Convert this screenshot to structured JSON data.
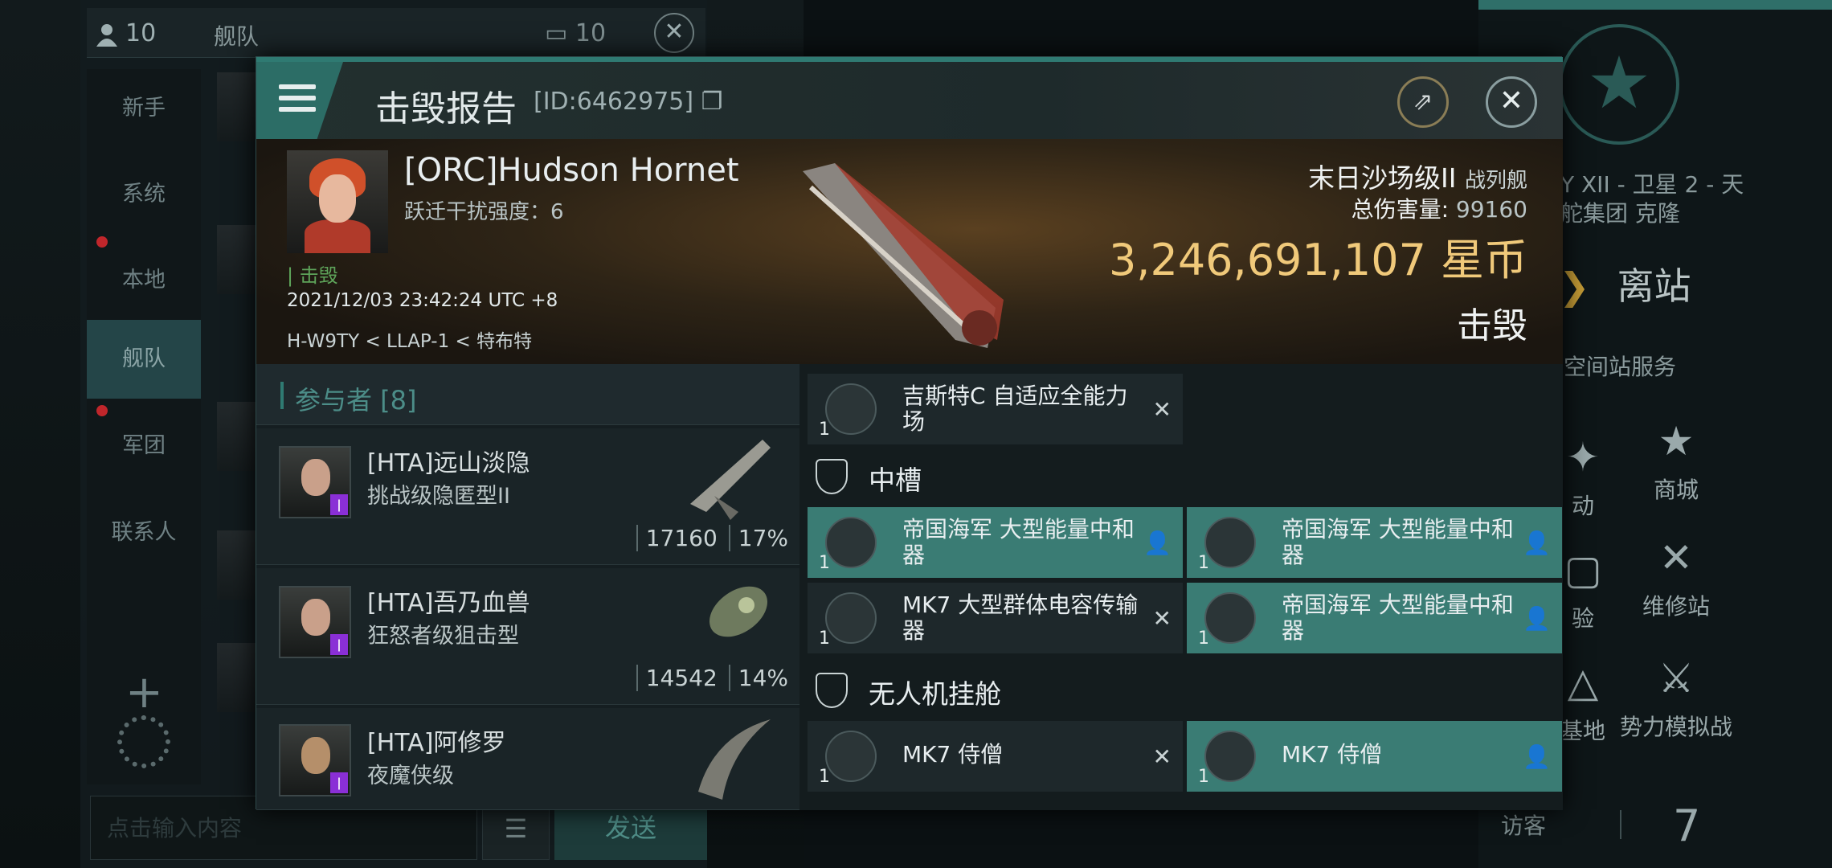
{
  "chat": {
    "member_count": "10",
    "tab": "舰队",
    "unread_count": "10",
    "channels": [
      "新手",
      "系统",
      "本地",
      "舰队",
      "军团",
      "联系人"
    ],
    "input_placeholder": "点击输入内容",
    "send_label": "发送"
  },
  "station": {
    "location_line1": "Y XII - 卫星 2 - 天",
    "location_line2": "舵集团 克隆",
    "undock_label": "离站",
    "services_title": "空间站服务",
    "services": [
      "动",
      "商城",
      "验",
      "维修站",
      "基地",
      "势力模拟战"
    ],
    "visitor_label": "访客",
    "visitor_count": "7"
  },
  "report": {
    "title": "击毁报告",
    "id": "[ID:6462975]",
    "victim": {
      "name": "[ORC]Hudson Hornet",
      "warp_disrupt": "跃迁干扰强度：6",
      "status": "击毁",
      "time": "2021/12/03 23:42:24 UTC +8",
      "location": "H-W9TY < LLAP-1 < 特布特"
    },
    "ship_class": "末日沙场级II",
    "ship_type": "战列舰",
    "total_damage_label": "总伤害量:",
    "total_damage": "99160",
    "isk_value": "3,246,691,107",
    "isk_unit": "星币",
    "result": "击毁",
    "participants_title": "参与者 [8]",
    "participants": [
      {
        "name": "[HTA]远山淡隐",
        "ship": "挑战级隐匿型II",
        "damage": "17160",
        "percent": "17%"
      },
      {
        "name": "[HTA]吾乃血兽",
        "ship": "狂怒者级狙击型",
        "damage": "14542",
        "percent": "14%"
      },
      {
        "name": "[HTA]阿修罗",
        "ship": "夜魔侠级",
        "damage": "",
        "percent": ""
      }
    ],
    "low_slot_item": {
      "qty": "1",
      "name": "吉斯特C 自适应全能力场"
    },
    "mid_slot_title": "中槽",
    "mid_slots": [
      {
        "qty": "1",
        "name": "帝国海军 大型能量中和器"
      },
      {
        "qty": "1",
        "name": "帝国海军 大型能量中和器"
      },
      {
        "qty": "1",
        "name": "MK7 大型群体电容传输器"
      },
      {
        "qty": "1",
        "name": "帝国海军 大型能量中和器"
      }
    ],
    "drone_title": "无人机挂舱",
    "drones": [
      {
        "qty": "1",
        "name": "MK7 侍僧"
      },
      {
        "qty": "1",
        "name": "MK7 侍僧"
      }
    ]
  }
}
